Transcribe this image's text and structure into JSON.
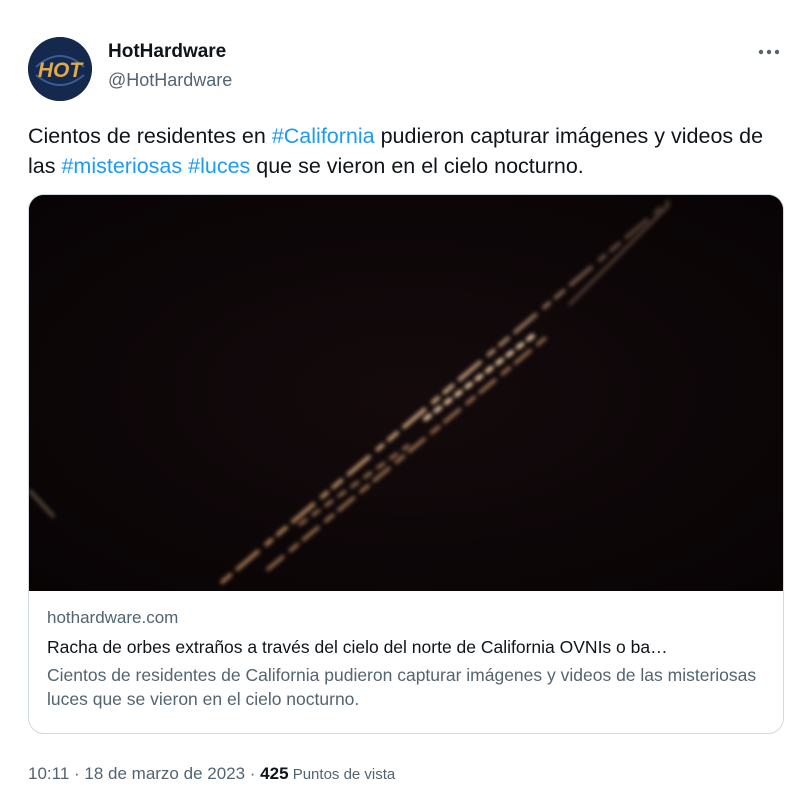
{
  "author": {
    "display_name": "HotHardware",
    "handle": "@HotHardware",
    "avatar_text": "HOT"
  },
  "tweet": {
    "text_parts": [
      {
        "type": "text",
        "value": "Cientos de residentes en "
      },
      {
        "type": "hashtag",
        "value": "#California"
      },
      {
        "type": "text",
        "value": " pudieron capturar imágenes y videos de las "
      },
      {
        "type": "hashtag",
        "value": "#misteriosas"
      },
      {
        "type": "text",
        "value": " "
      },
      {
        "type": "hashtag",
        "value": "#luces"
      },
      {
        "type": "text",
        "value": " que se vieron en el cielo nocturno."
      }
    ]
  },
  "card": {
    "domain": "hothardware.com",
    "title": "Racha de orbes extraños a través del cielo del norte de California OVNIs o ba…",
    "description": "Cientos de residentes de California pudieron capturar imágenes y videos de las misteriosas luces que se vieron en el cielo nocturno."
  },
  "footer": {
    "time": "10:11",
    "separator": " · ",
    "date": "18 de marzo de 2023",
    "separator2": " · ",
    "views_count": "425",
    "views_label": " Puntos de vista"
  },
  "icons": {
    "more": "more-horizontal-icon"
  },
  "colors": {
    "link": "#1d9bf0",
    "secondary_text": "#536471",
    "primary_text": "#0f1419",
    "avatar_bg": "#15294e",
    "logo_gold": "#d9a441"
  }
}
